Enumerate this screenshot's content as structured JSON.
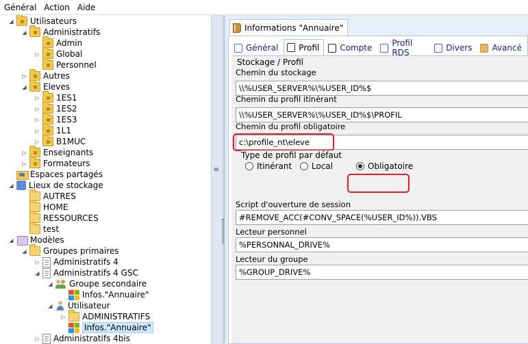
{
  "menu": [
    "Général",
    "Action",
    "Aide"
  ],
  "tree": [
    {
      "label": "Utilisateurs",
      "indent": 0,
      "exp": "◢",
      "icon": "folder-lock"
    },
    {
      "label": "Administratifs",
      "indent": 1,
      "exp": "◢",
      "icon": "folder-lock"
    },
    {
      "label": "Admin",
      "indent": 2,
      "exp": "",
      "icon": "folder-lock"
    },
    {
      "label": "Global",
      "indent": 2,
      "exp": "▷",
      "icon": "folder-lock"
    },
    {
      "label": "Personnel",
      "indent": 2,
      "exp": "",
      "icon": "folder-lock"
    },
    {
      "label": "Autres",
      "indent": 1,
      "exp": "▷",
      "icon": "folder-lock"
    },
    {
      "label": "Eleves",
      "indent": 1,
      "exp": "◢",
      "icon": "folder-lock"
    },
    {
      "label": "1ES1",
      "indent": 2,
      "exp": "▷",
      "icon": "folder-lock"
    },
    {
      "label": "1ES2",
      "indent": 2,
      "exp": "▷",
      "icon": "folder-lock"
    },
    {
      "label": "1ES3",
      "indent": 2,
      "exp": "▷",
      "icon": "folder-lock"
    },
    {
      "label": "1L1",
      "indent": 2,
      "exp": "▷",
      "icon": "folder-lock"
    },
    {
      "label": "B1MUC",
      "indent": 2,
      "exp": "▷",
      "icon": "folder-lock"
    },
    {
      "label": "Enseignants",
      "indent": 1,
      "exp": "▷",
      "icon": "folder-lock"
    },
    {
      "label": "Formateurs",
      "indent": 1,
      "exp": "▷",
      "icon": "folder-lock"
    },
    {
      "label": "Espaces partagés",
      "indent": 0,
      "exp": "",
      "icon": "shared-folder"
    },
    {
      "label": "Lieux de stockage",
      "indent": 0,
      "exp": "◢",
      "icon": "database"
    },
    {
      "label": "AUTRES",
      "indent": 1,
      "exp": "",
      "icon": "folder"
    },
    {
      "label": "HOME",
      "indent": 1,
      "exp": "",
      "icon": "folder"
    },
    {
      "label": "RESSOURCES",
      "indent": 1,
      "exp": "",
      "icon": "folder"
    },
    {
      "label": "test",
      "indent": 1,
      "exp": "",
      "icon": "folder"
    },
    {
      "label": "Modèles",
      "indent": 0,
      "exp": "◢",
      "icon": "template"
    },
    {
      "label": "Groupes primaires",
      "indent": 1,
      "exp": "◢",
      "icon": "folder-open"
    },
    {
      "label": "Administratifs 4",
      "indent": 2,
      "exp": "▷",
      "icon": "document"
    },
    {
      "label": "Administratifs 4 GSC",
      "indent": 2,
      "exp": "◢",
      "icon": "document"
    },
    {
      "label": "Groupe secondaire",
      "indent": 3,
      "exp": "◢",
      "icon": "group"
    },
    {
      "label": "Infos.\"Annuaire\"",
      "indent": 4,
      "exp": "",
      "icon": "windows-logo"
    },
    {
      "label": "Utilisateur",
      "indent": 3,
      "exp": "◢",
      "icon": "user"
    },
    {
      "label": "ADMINISTRATIFS",
      "indent": 4,
      "exp": "▷",
      "icon": "folder"
    },
    {
      "label": "Infos.\"Annuaire\"",
      "indent": 4,
      "exp": "",
      "icon": "windows-logo",
      "selected": true
    },
    {
      "label": "Administratifs 4bis",
      "indent": 2,
      "exp": "▷",
      "icon": "document"
    }
  ],
  "main_tab": "Informations \"Annuaire\"",
  "subtabs": [
    {
      "label": "Général",
      "icon": "user-icon",
      "active": false
    },
    {
      "label": "Profil",
      "icon": "profile-icon",
      "active": true
    },
    {
      "label": "Compte",
      "icon": "account-icon",
      "active": false
    },
    {
      "label": "Profil RDS",
      "icon": "rds-icon",
      "active": false
    },
    {
      "label": "Divers",
      "icon": "divers-icon",
      "active": false
    },
    {
      "label": "Avancé",
      "icon": "advanced-icon",
      "active": false
    }
  ],
  "section_title": "Stockage / Profil",
  "fields": {
    "storage_path_label": "Chemin du stockage",
    "storage_path": "\\\\%USER_SERVER%\\%USER_ID%$",
    "roaming_label": "Chemin du profil itinérant",
    "roaming": "\\\\%USER_SERVER%\\%USER_ID%$\\PROFIL",
    "mandatory_label": "Chemin du profil obligatoire",
    "mandatory": "c:\\profile_nt\\eleve",
    "profile_type_label": "Type de profil par défaut",
    "radio_itinerant": "Itinérant",
    "radio_local": "Local",
    "radio_obligatoire": "Obligatoire",
    "selected_profile_type": "Obligatoire",
    "script_label": "Script d'ouverture de session",
    "script": "#REMOVE_ACC(#CONV_SPACE(%USER_ID%)).VBS",
    "personal_drive_label": "Lecteur personnel",
    "personal_drive": "%PERSONNAL_DRIVE%",
    "group_drive_label": "Lecteur du groupe",
    "group_drive": "%GROUP_DRIVE%"
  },
  "colors": {
    "highlight": "#e0202a",
    "selection": "#cce8ff",
    "folder": "#f2c94c"
  }
}
